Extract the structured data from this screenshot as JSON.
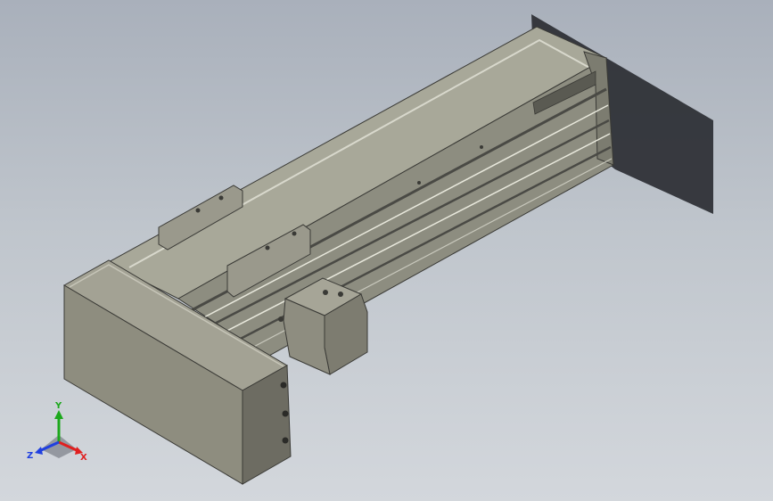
{
  "app": {
    "viewport_background": [
      "#a9b0bb",
      "#d3d7dc"
    ],
    "model_colors": {
      "body_top": "#a8a899",
      "body_side": "#8d8d80",
      "dark_groove": "#4a4a45",
      "shadow": "#2b2e33",
      "end_block_front": "#8e8d7f",
      "end_block_side": "#6d6c62"
    }
  },
  "triad": {
    "x_label": "X",
    "y_label": "Y",
    "z_label": "Z",
    "colors": {
      "x": "#e02020",
      "y": "#1ca81c",
      "z": "#2040e0"
    }
  }
}
